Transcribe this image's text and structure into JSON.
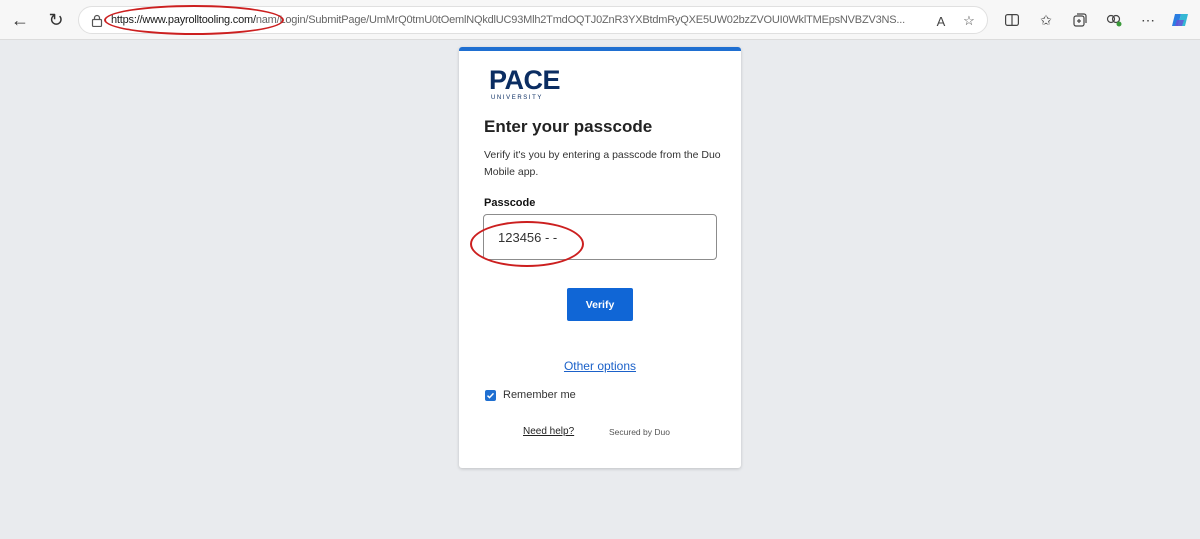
{
  "browser": {
    "url_host": "https://www.payrolltooling.com/",
    "url_path": "nam/Login/SubmitPage/UmMrQ0tmU0tOemlNQkdlUC93Mlh2TmdOQTJ0ZnR3YXBtdmRyQXE5UW02bzZVOUI0WklTMEpsNVBZV3NS...",
    "read_aloud": "A",
    "icons": [
      "back-icon",
      "refresh-icon",
      "lock-icon",
      "read-aloud-icon",
      "favorite-star-icon",
      "split-screen-icon",
      "favorites-icon",
      "collections-icon",
      "extensions-icon",
      "more-icon",
      "copilot-icon"
    ]
  },
  "card": {
    "logo_text": "PACE",
    "logo_subtext": "UNIVERSITY",
    "title": "Enter your passcode",
    "description": "Verify it's you by entering a passcode from the Duo Mobile app.",
    "field_label": "Passcode",
    "passcode_value": "123456 - -",
    "verify_label": "Verify",
    "other_options": "Other options",
    "remember_label": "Remember me",
    "remember_checked": true,
    "help_label": "Need help?",
    "secured_label": "Secured by Duo"
  },
  "colors": {
    "accent": "#1f6fd1",
    "button": "#1066d6",
    "brand": "#0b2d62",
    "annotation": "#cc1f1f",
    "background": "#e9ebee"
  }
}
